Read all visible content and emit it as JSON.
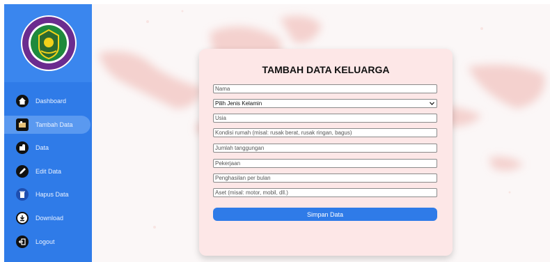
{
  "sidebar": {
    "logo_text_top": "DINAS SOSIAL",
    "logo_text_bottom": "KABUPATEN LUWU",
    "items": [
      {
        "label": "Dashboard",
        "icon": "home-icon"
      },
      {
        "label": "Tambah Data",
        "icon": "add-data-icon",
        "active": true
      },
      {
        "label": "Data",
        "icon": "data-icon"
      },
      {
        "label": "Edit Data",
        "icon": "pencil-icon"
      },
      {
        "label": "Hapus Data",
        "icon": "trash-icon"
      },
      {
        "label": "Download",
        "icon": "download-icon"
      },
      {
        "label": "Logout",
        "icon": "logout-icon"
      }
    ]
  },
  "form": {
    "title": "TAMBAH DATA KELUARGA",
    "fields": {
      "nama": "Nama",
      "jenis_kelamin": "Pilih Jenis Kelamin",
      "usia": "Usia",
      "kondisi_rumah": "Kondisi rumah (misal: rusak berat, rusak ringan, bagus)",
      "jumlah_tanggungan": "Jumlah tanggungan",
      "pekerjaan": "Pekerjaan",
      "penghasilan": "Penghasilan per bulan",
      "aset": "Aset (misal: motor, mobil, dll.)"
    },
    "submit_label": "Simpan Data"
  },
  "colors": {
    "sidebar": "#2f7be8",
    "card": "#fde7e7",
    "button": "#2f7be8",
    "map": "#f6d3d0"
  }
}
